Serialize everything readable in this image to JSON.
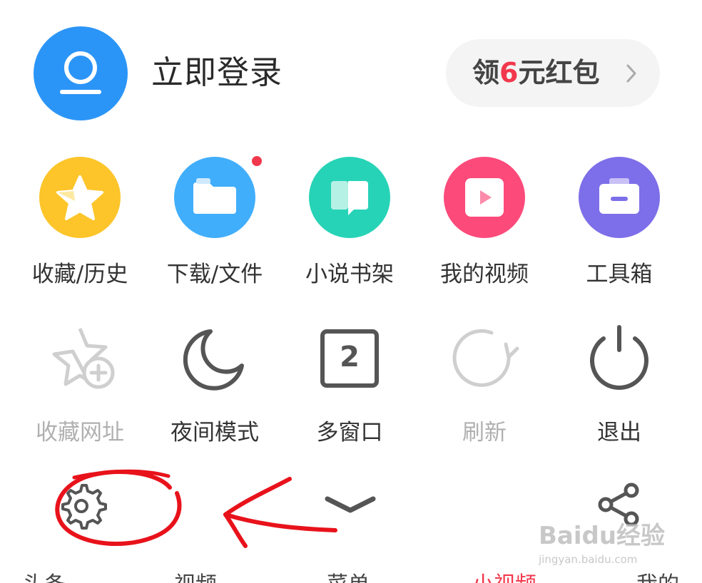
{
  "header": {
    "login_label": "立即登录",
    "coupon_prefix": "领",
    "coupon_amount": "6",
    "coupon_suffix": "元红包"
  },
  "features": [
    {
      "label": "收藏/历史",
      "icon": "star-icon",
      "color": "#fdc52a"
    },
    {
      "label": "下载/文件",
      "icon": "folder-icon",
      "color": "#41aefb",
      "badge": true
    },
    {
      "label": "小说书架",
      "icon": "book-icon",
      "color": "#27d3b7"
    },
    {
      "label": "我的视频",
      "icon": "video-play-icon",
      "color": "#fc4a7b"
    },
    {
      "label": "工具箱",
      "icon": "toolbox-icon",
      "color": "#7d6ee9"
    }
  ],
  "actions": [
    {
      "label": "收藏网址",
      "icon": "star-plus-icon",
      "enabled": false
    },
    {
      "label": "夜间模式",
      "icon": "moon-icon",
      "enabled": true
    },
    {
      "label": "多窗口",
      "icon": "window-count-icon",
      "enabled": true,
      "count": "2"
    },
    {
      "label": "刷新",
      "icon": "refresh-icon",
      "enabled": false
    },
    {
      "label": "退出",
      "icon": "power-icon",
      "enabled": true
    }
  ],
  "toolbar": {
    "settings_icon": "gear-icon",
    "collapse_icon": "chevron-down-icon",
    "share_icon": "share-icon"
  },
  "watermark": {
    "main": "Baidu经验",
    "sub": "jingyan.baidu.com"
  },
  "bottom_tabs": [
    {
      "label": "头条",
      "active": false
    },
    {
      "label": "视频",
      "active": false
    },
    {
      "label": "菜单",
      "active": false
    },
    {
      "label": "小视频",
      "active": true
    },
    {
      "label": "我的",
      "active": false
    }
  ],
  "colors": {
    "accent": "#2b95f7",
    "red": "#f2384c",
    "annotation": "#e8121b"
  }
}
